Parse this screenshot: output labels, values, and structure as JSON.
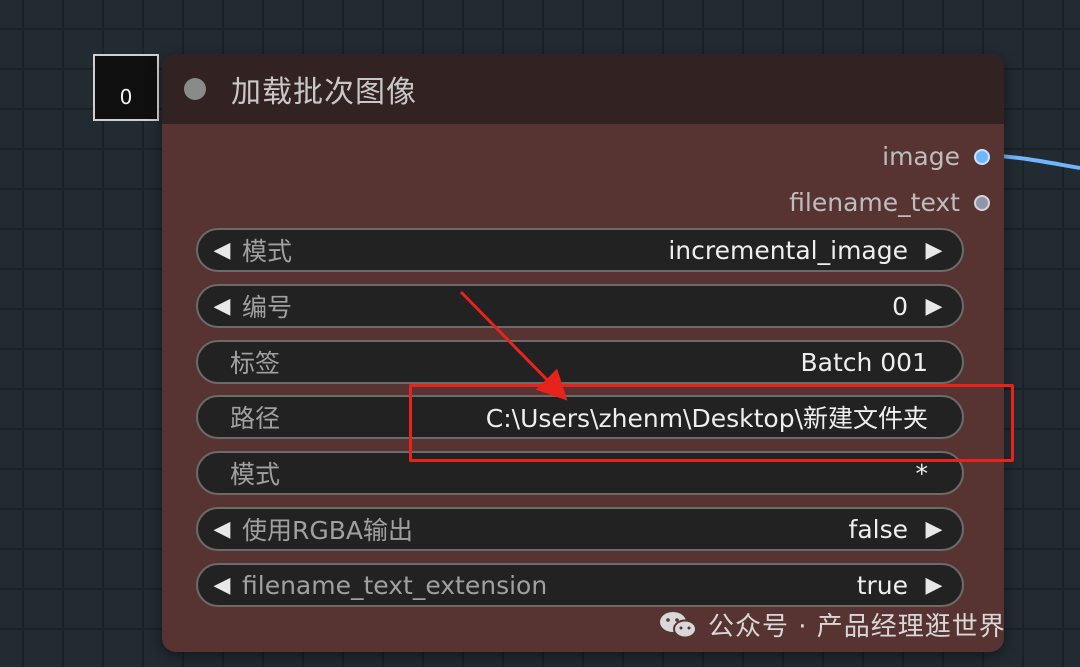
{
  "node": {
    "id_badge": "0",
    "title": "加载批次图像",
    "outputs": [
      {
        "label": "image",
        "color": "#6fb6ff"
      },
      {
        "label": "filename_text",
        "color": "#8e96a8"
      }
    ],
    "widgets": [
      {
        "label": "模式",
        "value": "incremental_image",
        "type": "combo"
      },
      {
        "label": "编号",
        "value": "0",
        "type": "number"
      },
      {
        "label": "标签",
        "value": "Batch 001",
        "type": "text"
      },
      {
        "label": "路径",
        "value": "C:\\Users\\zhenm\\Desktop\\新建文件夹",
        "type": "text"
      },
      {
        "label": "模式",
        "value": "*",
        "type": "text"
      },
      {
        "label": "使用RGBA输出",
        "value": "false",
        "type": "combo"
      },
      {
        "label": "filename_text_extension",
        "value": "true",
        "type": "combo"
      }
    ],
    "header_color": "#332222",
    "body_color": "#573432"
  },
  "annotation": {
    "highlight_color": "#e8231c",
    "target": "路径"
  },
  "watermark": {
    "text": "公众号 · 产品经理逛世界",
    "icon": "wechat-icon"
  }
}
